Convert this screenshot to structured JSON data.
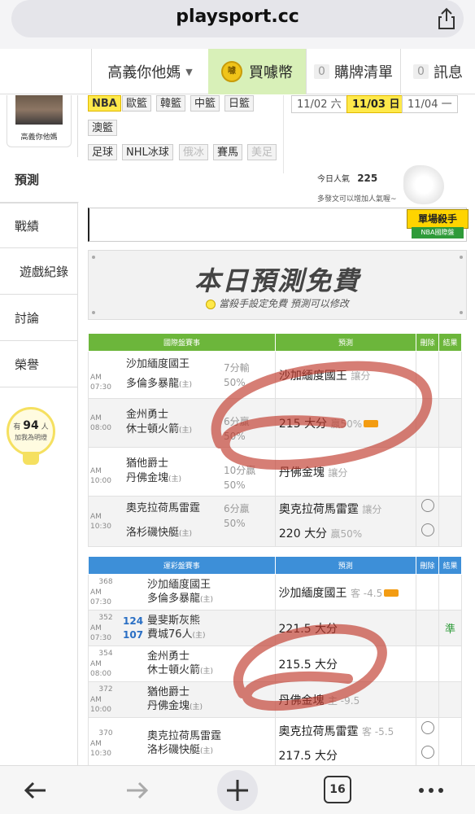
{
  "browser": {
    "url": "playsport.cc",
    "tab_count": "16"
  },
  "header": {
    "username": "高義你他媽",
    "coin_label": "買噱幣",
    "coin_icon_text": "噱",
    "cart_count": "0",
    "cart_label": "購牌清單",
    "msg_count": "0",
    "msg_label": "訊息"
  },
  "sidebar": {
    "avatar_name": "高義你他媽",
    "items": [
      "預測",
      "戰績",
      "遊戲紀錄",
      "討論",
      "榮譽"
    ],
    "fans_prefix": "有",
    "fans_count": "94",
    "fans_unit": "人",
    "fans_text": "加我為明燈"
  },
  "leagues": {
    "row1": [
      "NBA",
      "歐籃",
      "韓籃",
      "中籃",
      "日籃"
    ],
    "row2": [
      "澳籃"
    ],
    "row3": [
      "足球",
      "NHL冰球",
      "俄冰",
      "賽馬",
      "美足"
    ]
  },
  "dates": [
    "11/02 六",
    "11/03 日",
    "11/04 一"
  ],
  "popularity": {
    "label": "今日人氣",
    "value": "225",
    "note": "多發文可以增加人氣喔~"
  },
  "killer_badge": {
    "title": "單場殺手",
    "subtitle": "NBA國際盤"
  },
  "promo": {
    "title": "本日預測免費",
    "subtitle": "當殺手設定免費  預測可以修改"
  },
  "intl_table": {
    "headers": [
      "國際盤賽事",
      "預測",
      "刪除",
      "結果"
    ],
    "rows": [
      {
        "time": "AM 07:30",
        "team1": "沙加緬度國王",
        "team2": "多倫多暴龍",
        "home": "(主)",
        "spread1": "7分輸",
        "spread2": "50%",
        "pick": "沙加緬度國王",
        "pick_note": "讓分"
      },
      {
        "time": "AM 08:00",
        "team1": "金州勇士",
        "team2": "休士頓火箭",
        "home": "(主)",
        "spread1": "6分贏",
        "spread2": "50%",
        "pick": "215 大分",
        "pick_note": "贏50%"
      },
      {
        "time": "AM 10:00",
        "team1": "猶他爵士",
        "team2": "丹佛金塊",
        "home": "(主)",
        "spread1": "10分贏",
        "spread2": "50%",
        "pick": "丹佛金塊",
        "pick_note": "讓分"
      },
      {
        "time": "AM 10:30",
        "team1": "奧克拉荷馬雷霆",
        "team2": "洛杉磯快艇",
        "home": "(主)",
        "spread1": "6分贏",
        "spread2": "50%",
        "pick": "奧克拉荷馬雷霆",
        "pick_note": "讓分",
        "pick2": "220 大分",
        "pick2_note": "贏50%"
      }
    ]
  },
  "lottery_table": {
    "headers": [
      "運彩盤賽事",
      "預測",
      "刪除",
      "結果"
    ],
    "rows": [
      {
        "code": "368",
        "time": "AM 07:30",
        "team1": "沙加緬度國王",
        "team2": "多倫多暴龍",
        "home": "(主)",
        "pick": "沙加緬度國王",
        "pick_note": "客 -4.5"
      },
      {
        "code": "352",
        "time": "AM 07:30",
        "rank1": "124",
        "rank2": "107",
        "team1": "曼斐斯灰熊",
        "team2": "費城76人",
        "home": "(主)",
        "pick": "221.5 大分",
        "result": "準"
      },
      {
        "code": "354",
        "time": "AM 08:00",
        "team1": "金州勇士",
        "team2": "休士頓火箭",
        "home": "(主)",
        "pick": "215.5 大分"
      },
      {
        "code": "372",
        "time": "AM 10:00",
        "team1": "猶他爵士",
        "team2": "丹佛金塊",
        "home": "(主)",
        "pick": "丹佛金塊",
        "pick_note": "主 -9.5"
      },
      {
        "code": "370",
        "time": "AM 10:30",
        "team1": "奧克拉荷馬雷霆",
        "team2": "洛杉磯快艇",
        "home": "(主)",
        "pick": "奧克拉荷馬雷霆",
        "pick_note": "客 -5.5",
        "pick2": "217.5 大分"
      }
    ]
  },
  "colors": {
    "intl_header": "#6cb63b",
    "lottery_header": "#3d8fd8",
    "active_tag": "#ffe94a",
    "coin_bg": "#d8f0b8",
    "scribble": "#c0392b"
  }
}
